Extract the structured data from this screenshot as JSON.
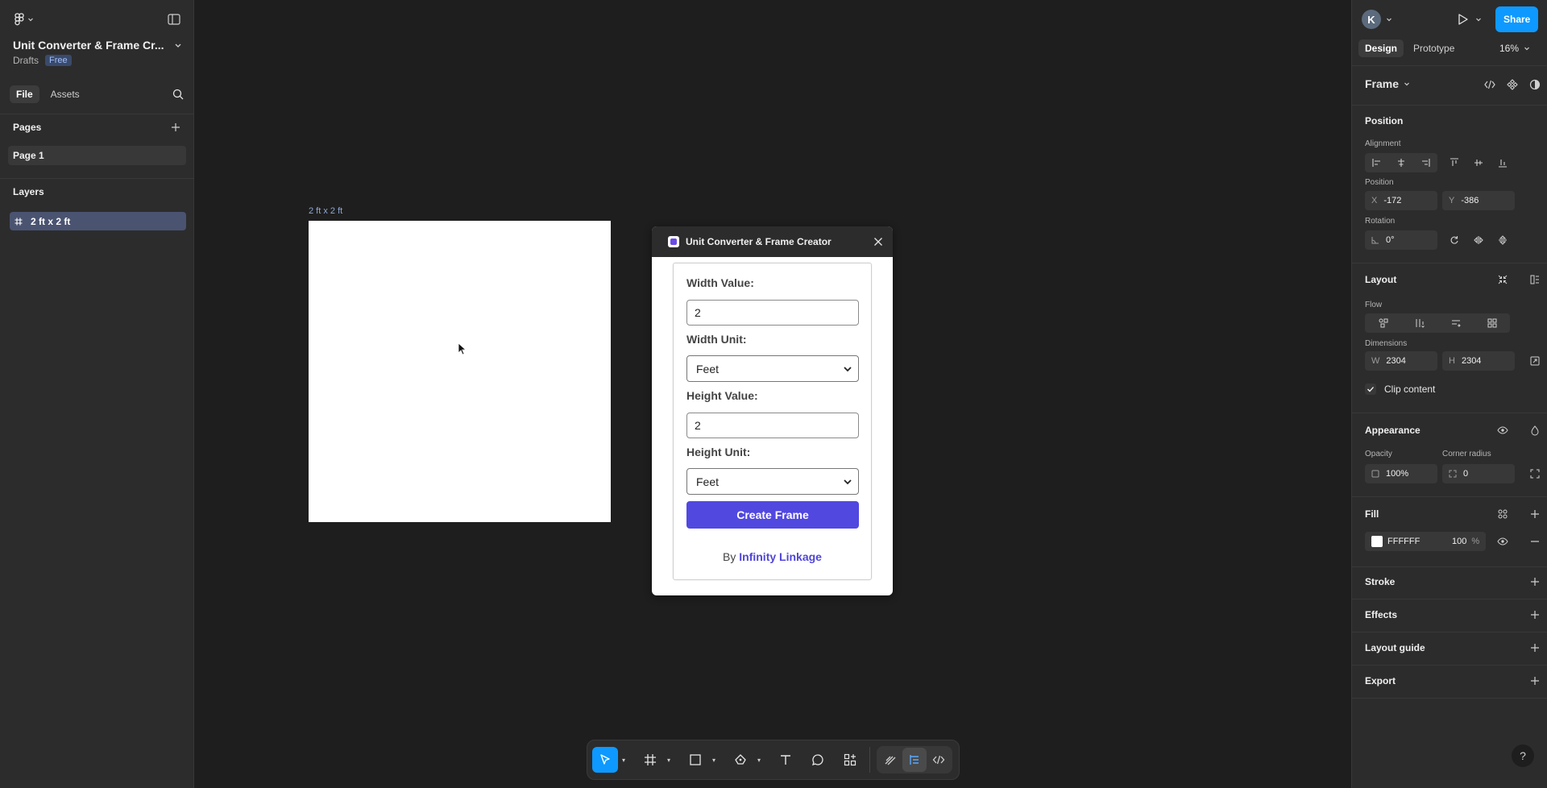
{
  "left_panel": {
    "file_name": "Unit Converter & Frame Cr...",
    "location": "Drafts",
    "plan_badge": "Free",
    "tabs": [
      "File",
      "Assets"
    ],
    "pages_header": "Pages",
    "pages": [
      "Page 1"
    ],
    "layers_header": "Layers",
    "layers": [
      "2 ft x 2 ft"
    ]
  },
  "canvas": {
    "frame_label": "2 ft x 2 ft"
  },
  "plugin": {
    "title": "Unit Converter & Frame Creator",
    "width_value_label": "Width Value:",
    "width_value": "2",
    "width_unit_label": "Width Unit:",
    "width_unit": "Feet",
    "height_value_label": "Height Value:",
    "height_value": "2",
    "height_unit_label": "Height Unit:",
    "height_unit": "Feet",
    "create_button": "Create Frame",
    "by_text": "By",
    "by_link": "Infinity Linkage"
  },
  "right_panel": {
    "avatar_initial": "K",
    "share_label": "Share",
    "tabs": [
      "Design",
      "Prototype"
    ],
    "zoom": "16%",
    "selection_type": "Frame",
    "position_header": "Position",
    "alignment_label": "Alignment",
    "position_label": "Position",
    "x_label": "X",
    "x_value": "-172",
    "y_label": "Y",
    "y_value": "-386",
    "rotation_label": "Rotation",
    "rotation_value": "0°",
    "layout_header": "Layout",
    "flow_label": "Flow",
    "dimensions_label": "Dimensions",
    "w_label": "W",
    "w_value": "2304",
    "h_label": "H",
    "h_value": "2304",
    "clip_content": "Clip content",
    "appearance_header": "Appearance",
    "opacity_label": "Opacity",
    "opacity_value": "100%",
    "corner_radius_label": "Corner radius",
    "corner_radius_value": "0",
    "fill_header": "Fill",
    "fill_hex": "FFFFFF",
    "fill_opacity": "100",
    "fill_opacity_unit": "%",
    "stroke_header": "Stroke",
    "effects_header": "Effects",
    "layout_guide_header": "Layout guide",
    "export_header": "Export",
    "help": "?"
  },
  "colors": {
    "accent": "#0d99ff",
    "plugin_button": "#5148e0",
    "link": "#4f46d8",
    "selected_layer": "#4a5370"
  }
}
